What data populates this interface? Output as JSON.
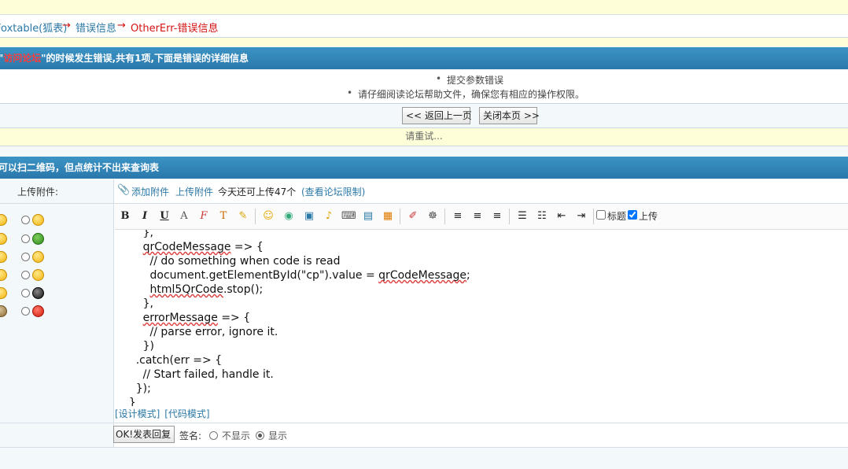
{
  "nav": {
    "forum_link": "Foxtable(狐表)",
    "arrow1": "→",
    "error_link": "错误信息",
    "arrow2": "→",
    "current": "OtherErr-错误信息"
  },
  "error_panel": {
    "title_quote_open": "\"",
    "title_action": "访问论坛",
    "title_rest": "\"的时候发生错误,共有1项,下面是错误的详细信息",
    "items": [
      "提交参数错误",
      "请仔细阅读论坛帮助文件，确保您有相应的操作权限。"
    ],
    "back_button": "<< 返回上一页",
    "close_button": "关闭本页 >>",
    "retry_text": "请重试..."
  },
  "reply_panel": {
    "title": "可以扫二维码，但点统计不出来查询表",
    "attach_label": "上传附件:",
    "add_attach": "添加附件",
    "upload_attach": "上传附件",
    "quota_text": "今天还可上传47个",
    "limit_link": "(查看论坛限制)"
  },
  "toolbar": {
    "bold": "B",
    "italic": "I",
    "underline": "U",
    "title_checkbox_label": "标题",
    "title_checked": false,
    "upload_checkbox_label": "上传",
    "upload_checked": true
  },
  "code_lines": [
    {
      "indent": "        ",
      "text": "},"
    },
    {
      "indent": "        ",
      "text": "qrCodeMessage => {",
      "squiggle": "qrCodeMessage"
    },
    {
      "indent": "          ",
      "text": "// do something when code is read"
    },
    {
      "indent": "          ",
      "text": "document.getElementById(\"cp\").value = qrCodeMessage;"
    },
    {
      "indent": "          ",
      "text": "html5QrCode.stop();",
      "squiggle": "html5QrCode"
    },
    {
      "indent": "        ",
      "text": "},"
    },
    {
      "indent": "        ",
      "text": "errorMessage => {",
      "squiggle": "errorMessage"
    },
    {
      "indent": "          ",
      "text": "// parse error, ignore it."
    },
    {
      "indent": "        ",
      "text": "})"
    },
    {
      "indent": "      ",
      "text": ".catch(err => {"
    },
    {
      "indent": "        ",
      "text": "// Start failed, handle it."
    },
    {
      "indent": "      ",
      "text": "});"
    },
    {
      "indent": "    ",
      "text": "}"
    }
  ],
  "editor_modes": {
    "design": "[设计模式]",
    "code": "[代码模式]"
  },
  "submit": {
    "button": "OK!发表回复",
    "signature_label": "签名:",
    "hide_label": "不显示",
    "show_label": "显示",
    "selected": "显示"
  },
  "colors": {
    "link": "#2b79a6",
    "error_red": "#d51313",
    "header_blue": "#2a78ac",
    "notice_yellow": "#fefed8"
  }
}
